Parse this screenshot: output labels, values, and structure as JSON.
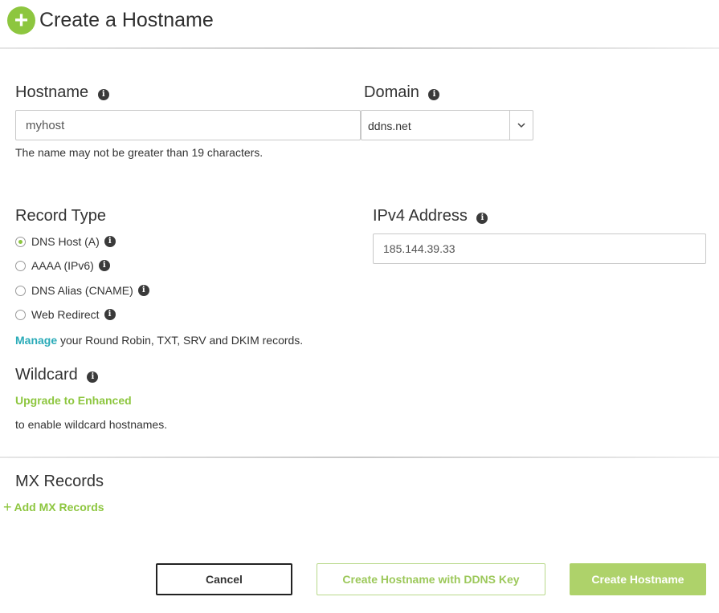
{
  "header": {
    "title": "Create a Hostname",
    "icon": "plus-circle-icon"
  },
  "hostname": {
    "label": "Hostname",
    "value": "myhost",
    "hint": "The name may not be greater than 19 characters."
  },
  "domain": {
    "label": "Domain",
    "selected": "ddns.net"
  },
  "record_type": {
    "label": "Record Type",
    "options": [
      "DNS Host (A)",
      "AAAA (IPv6)",
      "DNS Alias (CNAME)",
      "Web Redirect"
    ],
    "selected": "DNS Host (A)",
    "manage_link": "Manage",
    "manage_text": " your Round Robin, TXT, SRV and DKIM records."
  },
  "ipv4": {
    "label": "IPv4 Address",
    "value": "185.144.39.33"
  },
  "wildcard": {
    "label": "Wildcard",
    "upgrade_link": "Upgrade to Enhanced",
    "text": "to enable wildcard hostnames."
  },
  "mx": {
    "label": "MX Records",
    "add_link": "Add MX Records"
  },
  "buttons": {
    "cancel": "Cancel",
    "create_ddns": "Create Hostname with DDNS Key",
    "create": "Create Hostname"
  },
  "colors": {
    "accent_green": "#8dc63f",
    "link_teal": "#2aabb8",
    "button_green": "#aed26a"
  }
}
